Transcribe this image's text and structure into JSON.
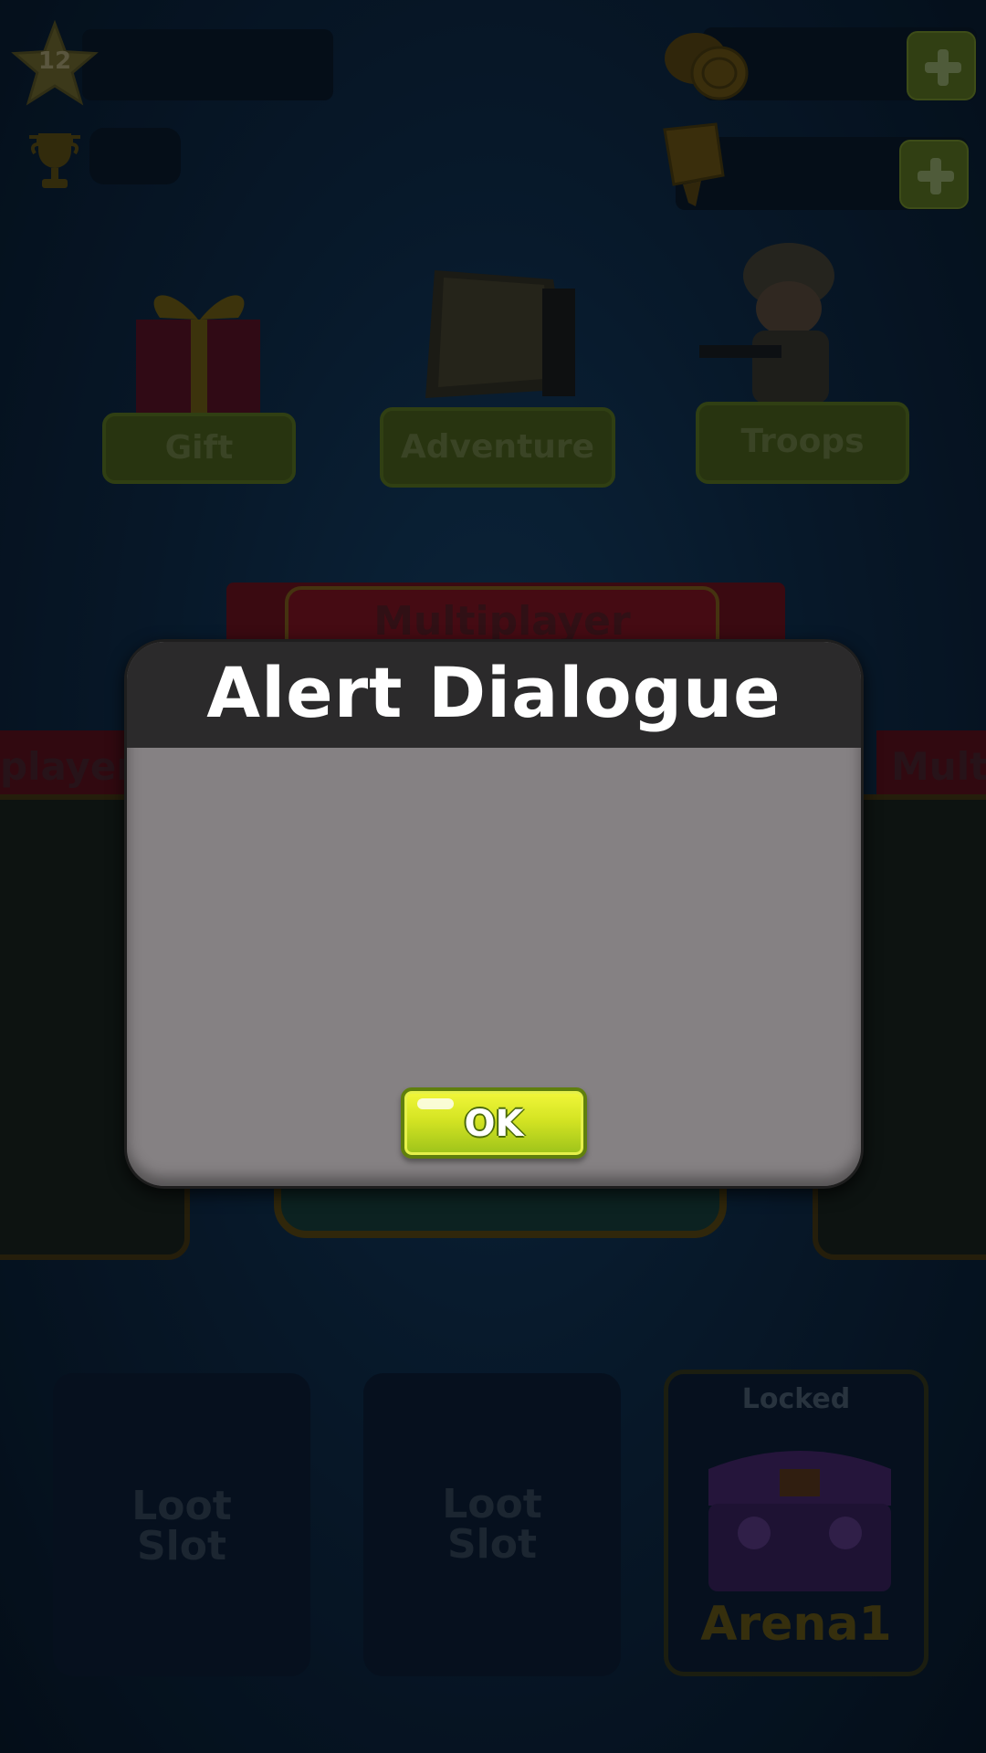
{
  "hud": {
    "level": "12",
    "xp_value": "",
    "trophies": "",
    "coins": "",
    "tickets": ""
  },
  "menu": {
    "gift_label": "Gift",
    "adventure_label": "Adventure",
    "troops_label": "Troops"
  },
  "modes": {
    "center_title": "Multiplayer",
    "left_tag": "player",
    "right_tag": "Multi"
  },
  "loot": {
    "slots": [
      {
        "line1": "Loot",
        "line2": "Slot"
      },
      {
        "line1": "Loot",
        "line2": "Slot"
      }
    ],
    "locked_slot": {
      "status": "Locked",
      "name": "Arena1"
    }
  },
  "dialog": {
    "title": "Alert Dialogue",
    "message": "",
    "ok_label": "OK"
  },
  "colors": {
    "dialog_header": "#2b2a2b",
    "dialog_body": "#858183",
    "ok_button": "#d4e423",
    "background": "#0c2238"
  }
}
